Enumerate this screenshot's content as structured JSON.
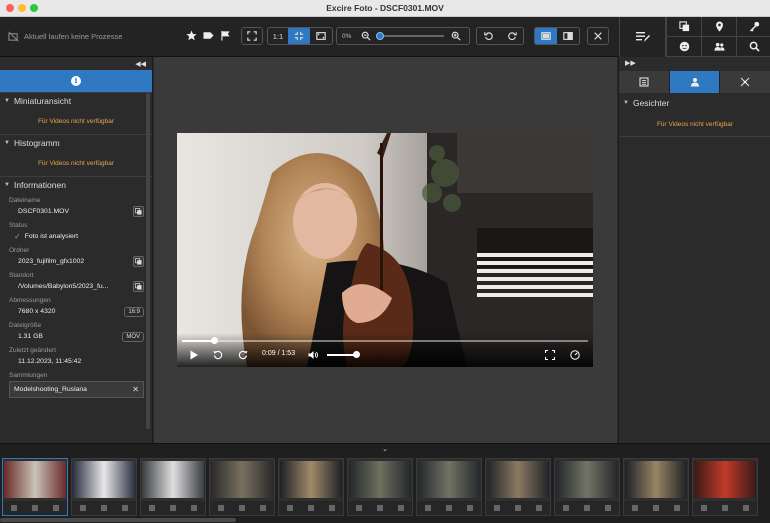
{
  "window": {
    "title": "Excire Foto - DSCF0301.MOV"
  },
  "toolbar": {
    "status": "Aktuell laufen keine Prozesse",
    "ratio_label": "1:1",
    "zoom_percent": "0%",
    "zoom_level": 0
  },
  "left_panel": {
    "sections": {
      "thumbnail": {
        "title": "Miniaturansicht",
        "na": "Für Videos nicht verfügbar"
      },
      "histogram": {
        "title": "Histogramm",
        "na": "Für Videos nicht verfügbar"
      },
      "info": {
        "title": "Informationen"
      }
    },
    "info": {
      "filename_label": "Dateiname",
      "filename": "DSCF0301.MOV",
      "status_label": "Status",
      "status": "Foto ist analysiert",
      "folder_label": "Ordner",
      "folder": "2023_fujifilm_gfx1002",
      "location_label": "Standort",
      "location": "/Volumes/Babylon5/2023_fu...",
      "dimensions_label": "Abmessungen",
      "dimensions": "7680 x 4320",
      "aspect": "16:9",
      "filesize_label": "Dateigröße",
      "filesize": "1.31 GB",
      "filetype": "MOV",
      "modified_label": "Zuletzt geändert",
      "modified": "11.12.2023, 11:45:42",
      "collections_label": "Sammlungen",
      "collection": "Modelshooting_Ruslana"
    }
  },
  "video": {
    "time": "0:09 / 1:53",
    "progress": 0.08,
    "volume": 0.9
  },
  "right_panel": {
    "section_title": "Gesichter",
    "na": "Für Videos nicht verfügbar"
  },
  "colors": {
    "accent": "#2e79c2",
    "warning_text": "#e8a64a"
  },
  "filmstrip": {
    "thumbs": [
      {
        "c1": "#6a2a2a",
        "c2": "#c9c2b8",
        "active": true
      },
      {
        "c1": "#2a3040",
        "c2": "#e8e8e8",
        "active": false
      },
      {
        "c1": "#3a3d42",
        "c2": "#dedede",
        "active": false
      },
      {
        "c1": "#2a2a2a",
        "c2": "#7a7060",
        "active": false
      },
      {
        "c1": "#1f2226",
        "c2": "#a08a6a",
        "active": false
      },
      {
        "c1": "#25282c",
        "c2": "#6e7060",
        "active": false
      },
      {
        "c1": "#26292d",
        "c2": "#707264",
        "active": false
      },
      {
        "c1": "#22252a",
        "c2": "#8a7a62",
        "active": false
      },
      {
        "c1": "#24272b",
        "c2": "#727466",
        "active": false
      },
      {
        "c1": "#1e2125",
        "c2": "#9a8466",
        "active": false
      },
      {
        "c1": "#3a1a18",
        "c2": "#c23a2a",
        "active": false
      }
    ]
  }
}
